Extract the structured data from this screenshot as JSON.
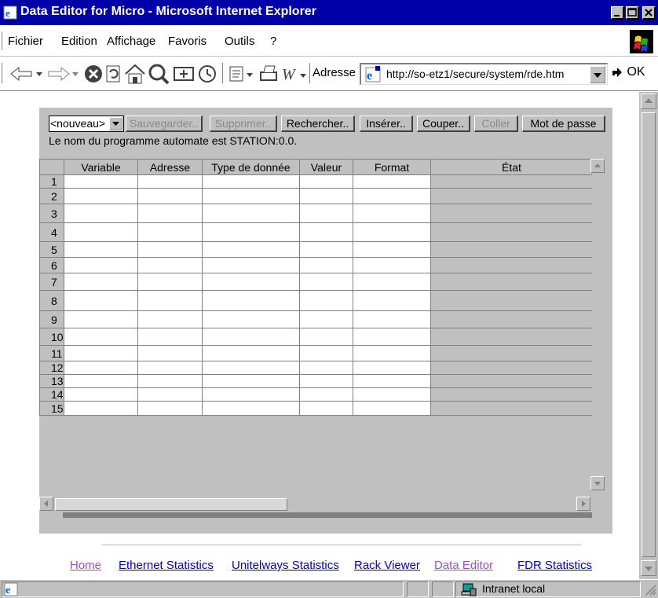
{
  "window": {
    "title": "Data Editor for Micro - Microsoft Internet Explorer",
    "title_bg": "#0000a8"
  },
  "menu": [
    "Fichier",
    "Edition",
    "Affichage",
    "Favoris",
    "Outils",
    "?"
  ],
  "address": {
    "label": "Adresse",
    "url": "http://so-etz1/secure/system/rde.htm",
    "go_label": "OK"
  },
  "applet": {
    "program_select": "<nouveau>",
    "buttons": [
      {
        "label": "Sauvegarder..",
        "enabled": false
      },
      {
        "label": "Supprimer..",
        "enabled": false
      },
      {
        "label": "Rechercher..",
        "enabled": true
      },
      {
        "label": "Insérer..",
        "enabled": true
      },
      {
        "label": "Couper..",
        "enabled": true
      },
      {
        "label": "Coller",
        "enabled": false
      },
      {
        "label": "Mot de passe",
        "enabled": true
      }
    ],
    "status": "Le nom du programme automate est STATION:0.0.",
    "columns": [
      "Variable",
      "Adresse",
      "Type de donnée",
      "Valeur",
      "Format",
      "État"
    ],
    "rows": [
      "1",
      "2",
      "3",
      "4",
      "5",
      "6",
      "7",
      "8",
      "9",
      "10",
      "11",
      "12",
      "13",
      "14",
      "15"
    ]
  },
  "footer_links": [
    {
      "label": "Home",
      "visited": true
    },
    {
      "label": "Ethernet Statistics",
      "visited": false
    },
    {
      "label": "Unitelways Statistics",
      "visited": false
    },
    {
      "label": "Rack Viewer",
      "visited": false
    },
    {
      "label": "Data Editor",
      "visited": true
    },
    {
      "label": "FDR Statistics",
      "visited": false
    }
  ],
  "statusbar": {
    "zone": "Intranet local"
  },
  "icons": [
    "ie-page-icon",
    "minimize-icon",
    "maximize-icon",
    "close-icon",
    "back-icon",
    "forward-icon",
    "stop-icon",
    "refresh-icon",
    "home-icon",
    "search-icon",
    "favorites-icon",
    "history-icon",
    "mail-icon",
    "print-icon",
    "edit-icon",
    "go-arrow-icon",
    "intranet-zone-icon"
  ]
}
